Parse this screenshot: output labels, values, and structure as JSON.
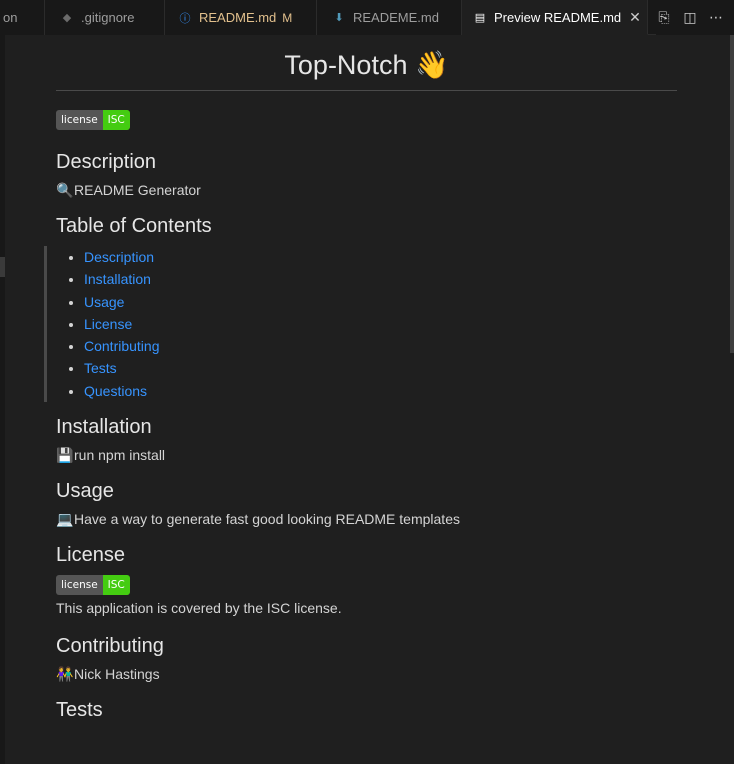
{
  "tabs": [
    {
      "label": "on"
    },
    {
      "label": ".gitignore",
      "icon": "gitignore-icon"
    },
    {
      "label": "README.md",
      "icon": "info-icon",
      "status": "M"
    },
    {
      "label": "READEME.md",
      "icon": "markdown-download-icon"
    },
    {
      "label": "Preview README.md",
      "icon": "preview-icon",
      "active": true
    }
  ],
  "actions": [
    "open-source-icon",
    "split-editor-icon",
    "more-actions-icon"
  ],
  "doc": {
    "title": "Top-Notch 👋",
    "badge": {
      "left": "license",
      "right": "ISC"
    },
    "description": {
      "heading": "Description",
      "emoji": "🔍",
      "text": "README Generator"
    },
    "toc": {
      "heading": "Table of Contents",
      "items": [
        "Description",
        "Installation",
        "Usage",
        "License",
        "Contributing",
        "Tests",
        "Questions"
      ]
    },
    "installation": {
      "heading": "Installation",
      "emoji": "💾",
      "text": "run npm install"
    },
    "usage": {
      "heading": "Usage",
      "emoji": "💻",
      "text": "Have a way to generate fast good looking README templates"
    },
    "license": {
      "heading": "License",
      "badge_left": "license",
      "badge_right": "ISC",
      "text": "This application is covered by the ISC license."
    },
    "contributing": {
      "heading": "Contributing",
      "emoji": "👫",
      "text": "Nick Hastings"
    },
    "tests": {
      "heading": "Tests"
    }
  },
  "colors": {
    "link": "#3794ff",
    "badge_green": "#44cc11",
    "badge_gray": "#555555",
    "modified": "#e2c08d"
  }
}
